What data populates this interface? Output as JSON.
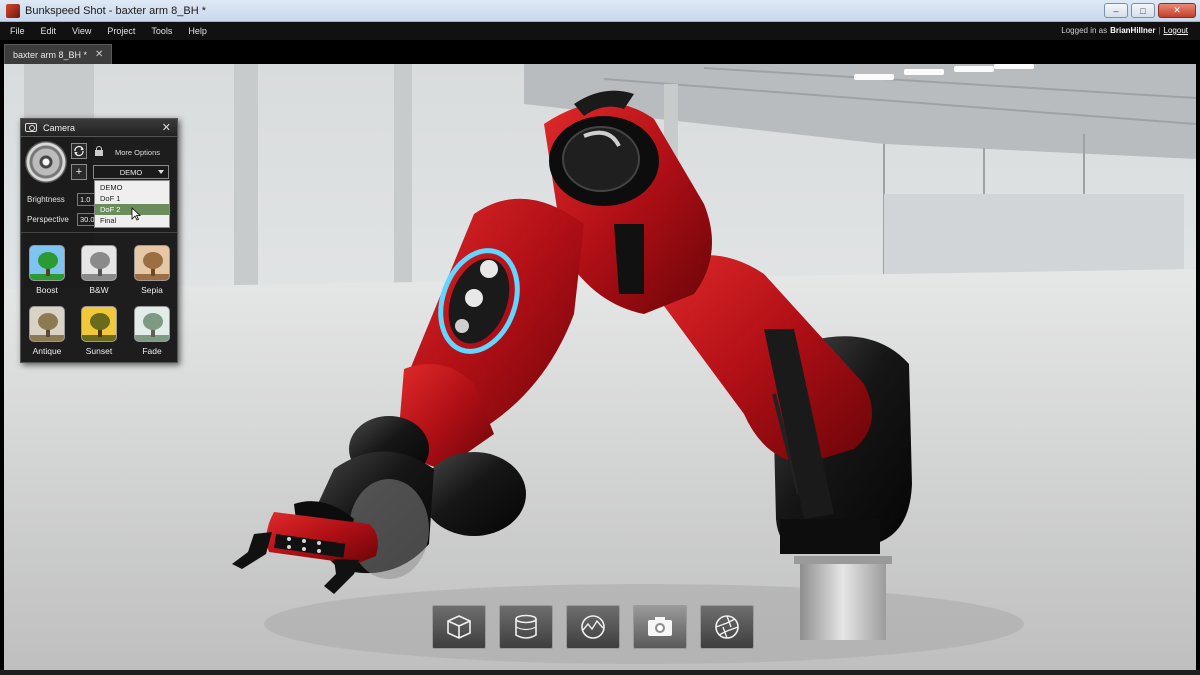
{
  "window": {
    "title": "Bunkspeed Shot - baxter arm 8_BH *",
    "controls": {
      "minimize": "–",
      "maximize": "□",
      "close": "✕"
    }
  },
  "menu": [
    "File",
    "Edit",
    "View",
    "Project",
    "Tools",
    "Help"
  ],
  "login": {
    "prefix": "Logged in as",
    "user": "BrianHillner",
    "separator": "|",
    "logout": "Logout"
  },
  "tab": {
    "label": "baxter arm 8_BH *",
    "close": "✕"
  },
  "camera_panel": {
    "title": "Camera",
    "close": "✕",
    "more_options": "More Options",
    "add_symbol": "+",
    "preset_value": "DEMO",
    "preset_options": [
      "DEMO",
      "DoF 1",
      "DoF 2",
      "Final"
    ],
    "highlighted_option": "DoF 2",
    "brightness": {
      "label": "Brightness",
      "value": "1.0"
    },
    "perspective": {
      "label": "Perspective",
      "value": "30.0"
    },
    "filters": [
      {
        "label": "Boost",
        "colors": [
          "#7fc3f0",
          "#2b9a32",
          "#5c3a1a"
        ]
      },
      {
        "label": "B&W",
        "colors": [
          "#e6e6e6",
          "#8a8a8a",
          "#555555"
        ]
      },
      {
        "label": "Sepia",
        "colors": [
          "#e7c8a6",
          "#9b6f43",
          "#6b4a2a"
        ]
      },
      {
        "label": "Antique",
        "colors": [
          "#d8d3c4",
          "#8c7a52",
          "#5a4a34"
        ]
      },
      {
        "label": "Sunset",
        "colors": [
          "#f2c83a",
          "#6a6a1c",
          "#4a3412"
        ]
      },
      {
        "label": "Fade",
        "colors": [
          "#e2ece8",
          "#7d9a82",
          "#5f5f55"
        ]
      }
    ]
  },
  "bottom_toolbar": [
    "model-cube-icon",
    "environment-cylinder-icon",
    "globe-icon",
    "camera-icon",
    "aperture-icon"
  ],
  "colors": {
    "arm_red": "#b00f16",
    "arm_black": "#121212",
    "floor": "#d6d6d6",
    "panel_bg": "#0c0c0c"
  }
}
